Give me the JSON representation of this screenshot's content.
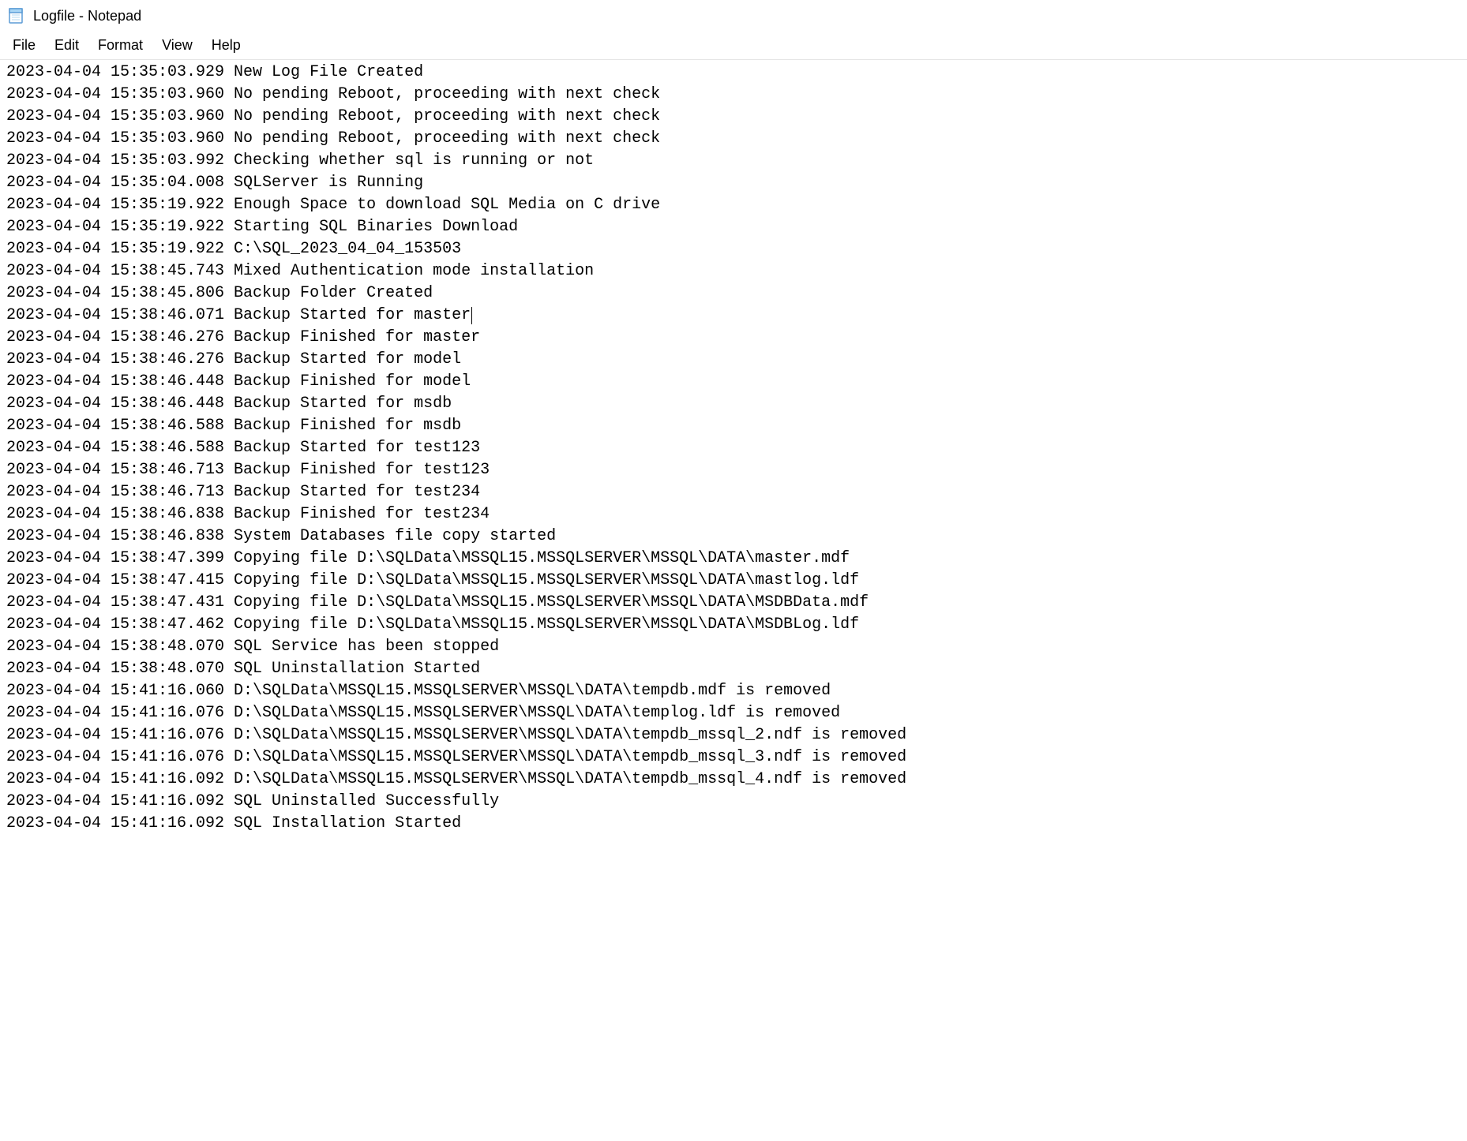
{
  "titlebar": {
    "title": "Logfile - Notepad"
  },
  "menu": {
    "file": "File",
    "edit": "Edit",
    "format": "Format",
    "view": "View",
    "help": "Help"
  },
  "log": {
    "lines": [
      "2023-04-04 15:35:03.929 New Log File Created",
      "2023-04-04 15:35:03.960 No pending Reboot, proceeding with next check",
      "2023-04-04 15:35:03.960 No pending Reboot, proceeding with next check",
      "2023-04-04 15:35:03.960 No pending Reboot, proceeding with next check",
      "2023-04-04 15:35:03.992 Checking whether sql is running or not",
      "2023-04-04 15:35:04.008 SQLServer is Running",
      "2023-04-04 15:35:19.922 Enough Space to download SQL Media on C drive",
      "2023-04-04 15:35:19.922 Starting SQL Binaries Download",
      "2023-04-04 15:35:19.922 C:\\SQL_2023_04_04_153503",
      "2023-04-04 15:38:45.743 Mixed Authentication mode installation",
      "2023-04-04 15:38:45.806 Backup Folder Created",
      "2023-04-04 15:38:46.071 Backup Started for master",
      "2023-04-04 15:38:46.276 Backup Finished for master",
      "2023-04-04 15:38:46.276 Backup Started for model",
      "2023-04-04 15:38:46.448 Backup Finished for model",
      "2023-04-04 15:38:46.448 Backup Started for msdb",
      "2023-04-04 15:38:46.588 Backup Finished for msdb",
      "2023-04-04 15:38:46.588 Backup Started for test123",
      "2023-04-04 15:38:46.713 Backup Finished for test123",
      "2023-04-04 15:38:46.713 Backup Started for test234",
      "2023-04-04 15:38:46.838 Backup Finished for test234",
      "2023-04-04 15:38:46.838 System Databases file copy started",
      "2023-04-04 15:38:47.399 Copying file D:\\SQLData\\MSSQL15.MSSQLSERVER\\MSSQL\\DATA\\master.mdf",
      "2023-04-04 15:38:47.415 Copying file D:\\SQLData\\MSSQL15.MSSQLSERVER\\MSSQL\\DATA\\mastlog.ldf",
      "2023-04-04 15:38:47.431 Copying file D:\\SQLData\\MSSQL15.MSSQLSERVER\\MSSQL\\DATA\\MSDBData.mdf",
      "2023-04-04 15:38:47.462 Copying file D:\\SQLData\\MSSQL15.MSSQLSERVER\\MSSQL\\DATA\\MSDBLog.ldf",
      "2023-04-04 15:38:48.070 SQL Service has been stopped",
      "2023-04-04 15:38:48.070 SQL Uninstallation Started",
      "2023-04-04 15:41:16.060 D:\\SQLData\\MSSQL15.MSSQLSERVER\\MSSQL\\DATA\\tempdb.mdf is removed",
      "2023-04-04 15:41:16.076 D:\\SQLData\\MSSQL15.MSSQLSERVER\\MSSQL\\DATA\\templog.ldf is removed",
      "2023-04-04 15:41:16.076 D:\\SQLData\\MSSQL15.MSSQLSERVER\\MSSQL\\DATA\\tempdb_mssql_2.ndf is removed",
      "2023-04-04 15:41:16.076 D:\\SQLData\\MSSQL15.MSSQLSERVER\\MSSQL\\DATA\\tempdb_mssql_3.ndf is removed",
      "2023-04-04 15:41:16.092 D:\\SQLData\\MSSQL15.MSSQLSERVER\\MSSQL\\DATA\\tempdb_mssql_4.ndf is removed",
      "2023-04-04 15:41:16.092 SQL Uninstalled Successfully",
      "2023-04-04 15:41:16.092 SQL Installation Started"
    ],
    "caret_line_index": 11
  }
}
